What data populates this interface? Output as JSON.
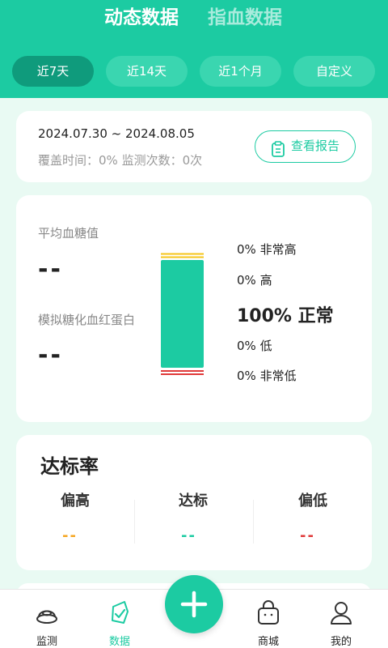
{
  "top_tabs": {
    "dynamic": "动态数据",
    "finger": "指血数据"
  },
  "range_tabs": [
    "近7天",
    "近14天",
    "近1个月",
    "自定义"
  ],
  "summary": {
    "date_range": "2024.07.30 ~ 2024.08.05",
    "coverage": "覆盖时间：0% 监测次数：0次",
    "report_button": "查看报告"
  },
  "glucose": {
    "avg_label": "平均血糖值",
    "avg_value": "--",
    "hba1c_label": "模拟糖化血红蛋白",
    "hba1c_value": "--",
    "distribution": [
      {
        "percent": "0%",
        "label": "非常高",
        "color": "#f5c518"
      },
      {
        "percent": "0%",
        "label": "高",
        "color": "#f5c518"
      },
      {
        "percent": "100%",
        "label": "正常",
        "color": "#1ccba2"
      },
      {
        "percent": "0%",
        "label": "低",
        "color": "#e03a3a"
      },
      {
        "percent": "0%",
        "label": "非常低",
        "color": "#e03a3a"
      }
    ]
  },
  "rate": {
    "title": "达标率",
    "columns": [
      {
        "label": "偏高",
        "value": "--",
        "color": "#f5a623"
      },
      {
        "label": "达标",
        "value": "--",
        "color": "#1ccba2"
      },
      {
        "label": "偏低",
        "value": "--",
        "color": "#e03a3a"
      }
    ]
  },
  "nav": {
    "items": [
      {
        "label": "监测",
        "icon": "monitor-icon"
      },
      {
        "label": "数据",
        "icon": "data-icon"
      },
      {
        "label": "商城",
        "icon": "shop-bag-icon"
      },
      {
        "label": "我的",
        "icon": "profile-icon"
      }
    ],
    "fab_icon": "plus-icon"
  },
  "colors": {
    "accent": "#1ccba2",
    "accent_dark": "#0f9b7c",
    "background": "#e9faf3"
  }
}
